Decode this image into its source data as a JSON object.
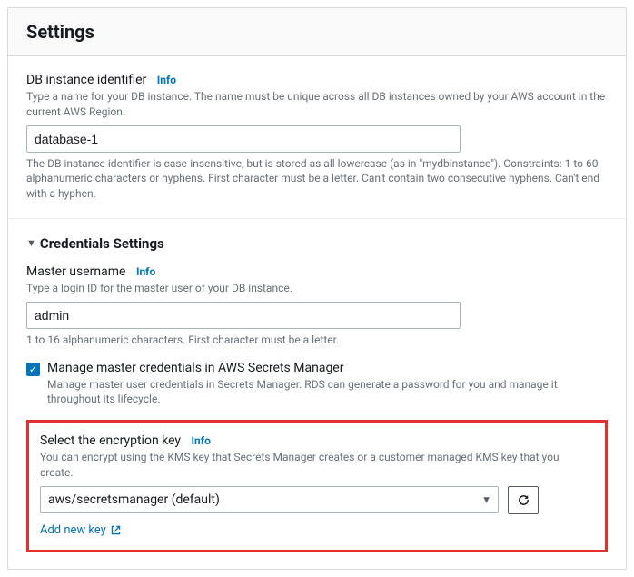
{
  "panel": {
    "title": "Settings"
  },
  "info_label": "Info",
  "db_identifier": {
    "label": "DB instance identifier",
    "helper": "Type a name for your DB instance. The name must be unique across all DB instances owned by your AWS account in the current AWS Region.",
    "value": "database-1",
    "constraint": "The DB instance identifier is case-insensitive, but is stored as all lowercase (as in \"mydbinstance\"). Constraints: 1 to 60 alphanumeric characters or hyphens. First character must be a letter. Can't contain two consecutive hyphens. Can't end with a hyphen."
  },
  "credentials": {
    "section_title": "Credentials Settings",
    "master_username": {
      "label": "Master username",
      "helper": "Type a login ID for the master user of your DB instance.",
      "value": "admin",
      "constraint": "1 to 16 alphanumeric characters. First character must be a letter."
    },
    "manage_secrets": {
      "label": "Manage master credentials in AWS Secrets Manager",
      "desc": "Manage master user credentials in Secrets Manager. RDS can generate a password for you and manage it throughout its lifecycle.",
      "checked": true
    },
    "encryption": {
      "label": "Select the encryption key",
      "helper": "You can encrypt using the KMS key that Secrets Manager creates or a customer managed KMS key that you create.",
      "selected": "aws/secretsmanager (default)",
      "add_new": "Add new key"
    }
  }
}
